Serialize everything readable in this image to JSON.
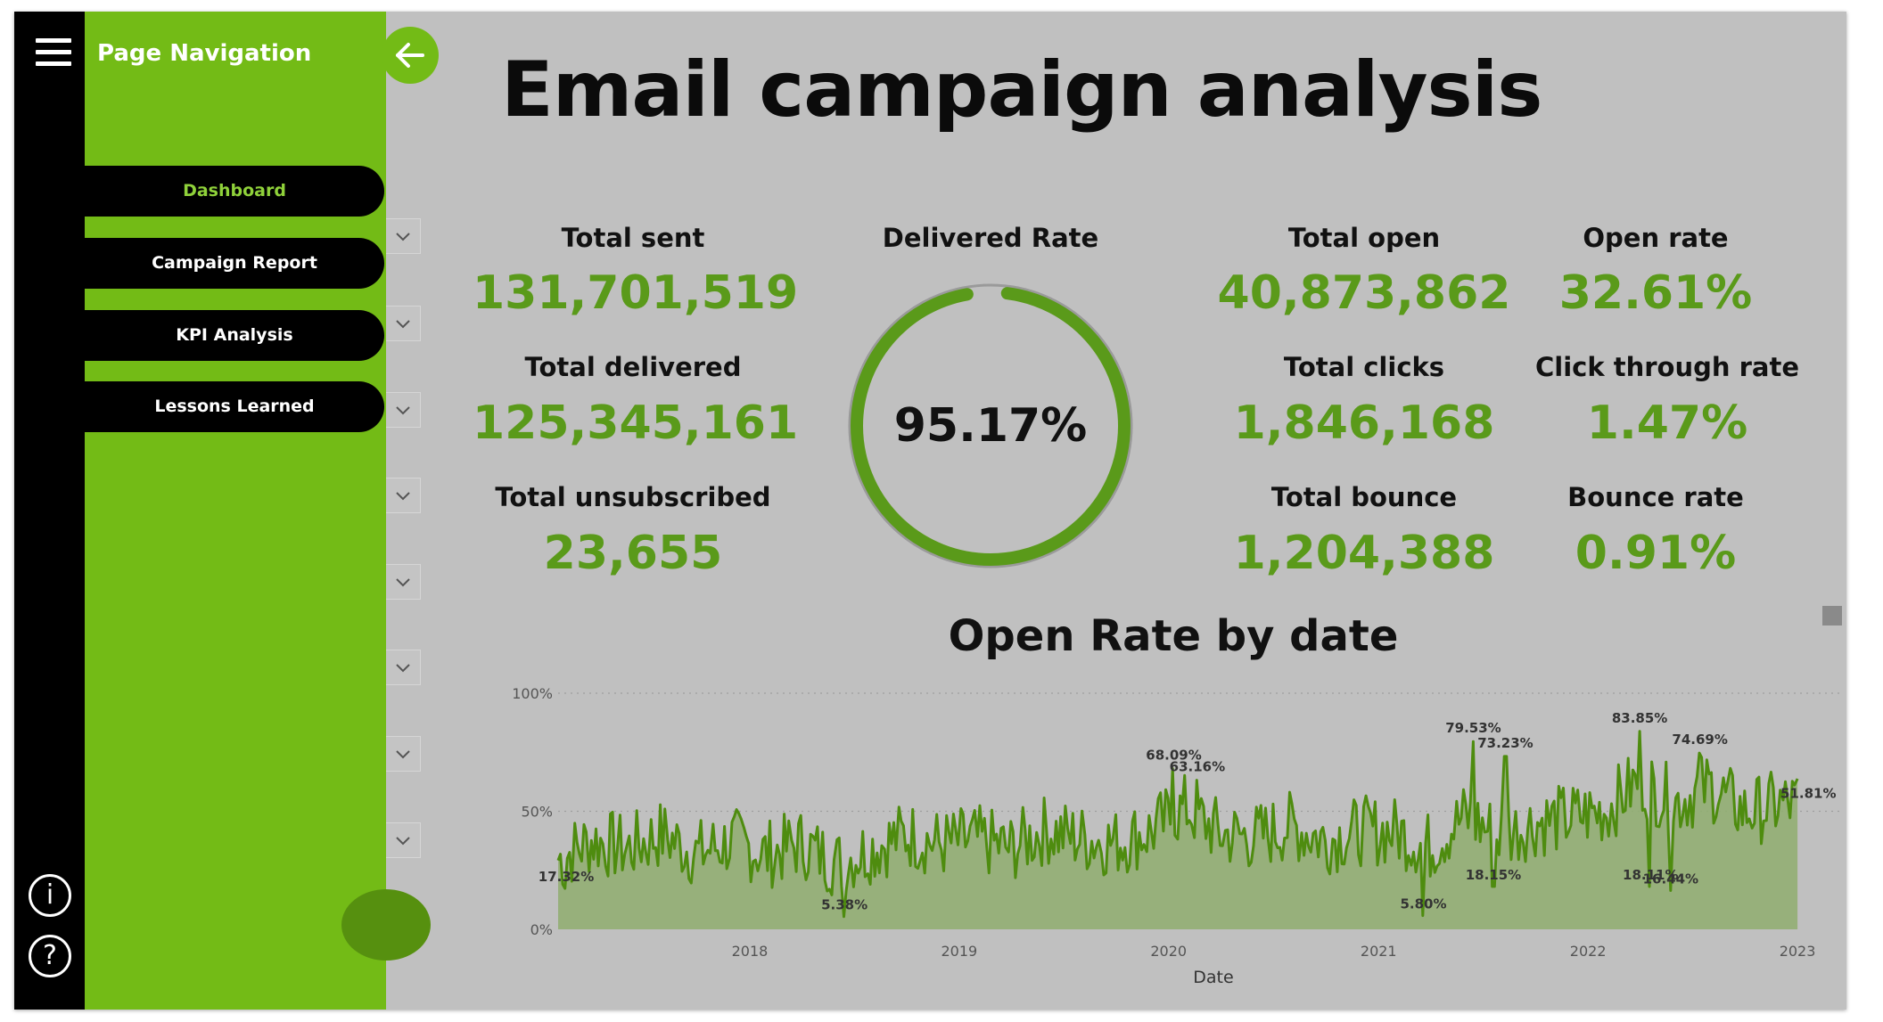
{
  "nav": {
    "title": "Page Navigation",
    "items": [
      {
        "label": "Dashboard",
        "active": true
      },
      {
        "label": "Campaign Report",
        "active": false
      },
      {
        "label": "KPI Analysis",
        "active": false
      },
      {
        "label": "Lessons Learned",
        "active": false
      }
    ],
    "icons": [
      "hamburger-menu-icon",
      "back-arrow-icon",
      "info-icon",
      "help-icon",
      "chevron-down-icon"
    ],
    "info_glyph": "i",
    "help_glyph": "?"
  },
  "header": {
    "title": "Email campaign analysis"
  },
  "kpis": {
    "total_sent": {
      "label": "Total sent",
      "value": "131,701,519"
    },
    "total_delivered": {
      "label": "Total delivered",
      "value": "125,345,161"
    },
    "total_unsubscribed": {
      "label": "Total unsubscribed",
      "value": "23,655"
    },
    "total_open": {
      "label": "Total open",
      "value": "40,873,862"
    },
    "open_rate": {
      "label": "Open rate",
      "value": "32.61%"
    },
    "total_clicks": {
      "label": "Total clicks",
      "value": "1,846,168"
    },
    "ctr": {
      "label": "Click through rate",
      "value": "1.47%"
    },
    "total_bounce": {
      "label": "Total bounce",
      "value": "1,204,388"
    },
    "bounce_rate": {
      "label": "Bounce rate",
      "value": "0.91%"
    }
  },
  "delivered": {
    "label": "Delivered Rate",
    "value": "95.17%",
    "fraction": 0.9517
  },
  "colors": {
    "accent": "#73bb16",
    "kpi_value": "#5a9a1a",
    "line": "#4e8c0f",
    "area": "#8fad6f",
    "background": "#c0c0c0",
    "rail": "#000000"
  },
  "chart_data": {
    "type": "area",
    "title": "Open Rate by date",
    "xlabel": "Date",
    "ylabel": "",
    "y_ticks": [
      "0%",
      "50%",
      "100%"
    ],
    "ylim": [
      0,
      100
    ],
    "x_ticks": [
      "2018",
      "2019",
      "2020",
      "2021",
      "2022",
      "2023"
    ],
    "xlim": [
      "2017-02-01",
      "2023-02-01"
    ],
    "grid": true,
    "labeled_points": [
      {
        "date": "2017-02-15",
        "value": 17.32,
        "label": "17.32%"
      },
      {
        "date": "2018-06-15",
        "value": 5.38,
        "label": "5.38%"
      },
      {
        "date": "2020-01-10",
        "value": 68.09,
        "label": "68.09%"
      },
      {
        "date": "2020-02-20",
        "value": 63.16,
        "label": "63.16%"
      },
      {
        "date": "2021-03-20",
        "value": 5.8,
        "label": "5.80%"
      },
      {
        "date": "2021-06-15",
        "value": 79.53,
        "label": "79.53%"
      },
      {
        "date": "2021-08-10",
        "value": 73.23,
        "label": "73.23%"
      },
      {
        "date": "2021-07-20",
        "value": 18.15,
        "label": "18.15%"
      },
      {
        "date": "2022-04-01",
        "value": 83.85,
        "label": "83.85%"
      },
      {
        "date": "2022-04-20",
        "value": 18.11,
        "label": "18.11%"
      },
      {
        "date": "2022-05-25",
        "value": 16.44,
        "label": "16.44%"
      },
      {
        "date": "2022-07-15",
        "value": 74.69,
        "label": "74.69%"
      },
      {
        "date": "2023-01-20",
        "value": 51.81,
        "label": "51.81%"
      }
    ],
    "series": [
      {
        "dates": [
          "2017-02",
          "2017-04",
          "2017-06",
          "2017-08",
          "2017-10",
          "2017-12",
          "2018-02",
          "2018-04",
          "2018-06",
          "2018-08",
          "2018-10",
          "2018-12",
          "2019-02",
          "2019-04",
          "2019-06",
          "2019-08",
          "2019-10",
          "2019-12",
          "2020-02",
          "2020-04",
          "2020-06",
          "2020-08",
          "2020-10",
          "2020-12",
          "2021-02",
          "2021-04",
          "2021-06",
          "2021-08",
          "2021-10",
          "2021-12",
          "2022-02",
          "2022-04",
          "2022-06",
          "2022-08",
          "2022-10",
          "2022-12",
          "2023-01"
        ],
        "values": [
          17,
          40,
          28,
          45,
          20,
          35,
          18,
          30,
          5,
          22,
          38,
          25,
          30,
          18,
          40,
          28,
          22,
          35,
          63,
          30,
          25,
          38,
          20,
          30,
          28,
          8,
          45,
          20,
          35,
          40,
          48,
          84,
          55,
          75,
          42,
          50,
          52
        ]
      }
    ]
  }
}
